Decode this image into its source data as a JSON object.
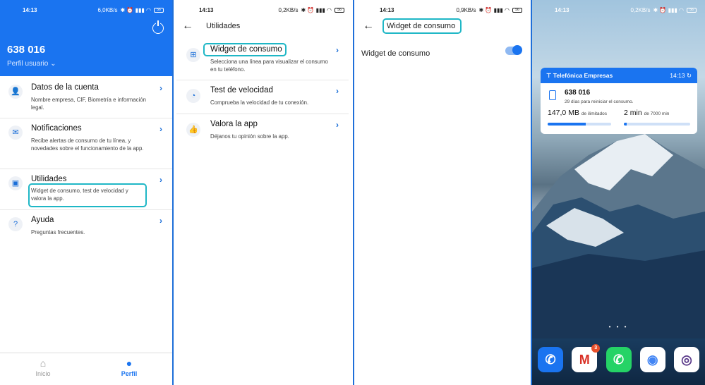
{
  "panel1": {
    "status": {
      "time": "14:13",
      "right": "6,0KB/s",
      "battery": "56"
    },
    "phone": "638 016",
    "profile_label": "Perfil usuario",
    "items": [
      {
        "title": "Datos de la cuenta",
        "desc": "Nombre empresa, CIF, Biometría e información legal.",
        "icon": "person-icon",
        "glyph": "👤"
      },
      {
        "title": "Notificaciones",
        "desc": "Recibe alertas de consumo de tu línea, y novedades sobre el funcionamiento de la app.",
        "icon": "mail-icon",
        "glyph": "✉"
      },
      {
        "title": "Utilidades",
        "desc": "Widget de consumo, test de velocidad y valora la app.",
        "icon": "box-icon",
        "glyph": "▣"
      },
      {
        "title": "Ayuda",
        "desc": "Preguntas frecuentes.",
        "icon": "help-icon",
        "glyph": "?"
      }
    ],
    "tabs": [
      {
        "label": "Inicio",
        "glyph": "⌂"
      },
      {
        "label": "Perfil",
        "glyph": "●"
      }
    ]
  },
  "panel2": {
    "status": {
      "time": "14:13",
      "right": "0,2KB/s",
      "battery": "56"
    },
    "title": "Utilidades",
    "items": [
      {
        "title": "Widget de consumo",
        "desc": "Selecciona una línea para visualizar el consumo en tu teléfono.",
        "icon": "widget-icon",
        "glyph": "⊞"
      },
      {
        "title": "Test de velocidad",
        "desc": "Comprueba la velocidad de tu conexión.",
        "icon": "speedometer-icon",
        "glyph": "◔"
      },
      {
        "title": "Valora la app",
        "desc": "Déjanos tu opinión sobre la app.",
        "icon": "thumbs-up-icon",
        "glyph": "👍"
      }
    ]
  },
  "panel3": {
    "status": {
      "time": "14:13",
      "right": "0,9KB/s",
      "battery": "56"
    },
    "title": "Widget de consumo",
    "toggle_label": "Widget de consumo",
    "toggle_on": true
  },
  "panel4": {
    "status": {
      "time": "14:13",
      "right": "0,2KB/s",
      "battery": "56"
    },
    "widget": {
      "brand": "Telefónica Empresas",
      "time": "14:13",
      "phone": "638 016",
      "subtitle": "29 días para reiniciar el consumo.",
      "data_value": "147,0 MB",
      "data_unit": "de ilimitados",
      "min_value": "2 min",
      "min_unit": "de 7000 min"
    },
    "dock": [
      {
        "name": "phone-app-icon",
        "glyph": "✆",
        "color": "#1a74f0"
      },
      {
        "name": "gmail-app-icon",
        "glyph": "M",
        "color": "#ffffff",
        "badge": "3"
      },
      {
        "name": "whatsapp-app-icon",
        "glyph": "✆",
        "color": "#25d366"
      },
      {
        "name": "chrome-app-icon",
        "glyph": "◉",
        "color": "#ffffff"
      },
      {
        "name": "camera-app-icon",
        "glyph": "◎",
        "color": "#ffffff"
      }
    ]
  },
  "colors": {
    "accent": "#1a74f0",
    "highlight": "#1fb7c6"
  }
}
